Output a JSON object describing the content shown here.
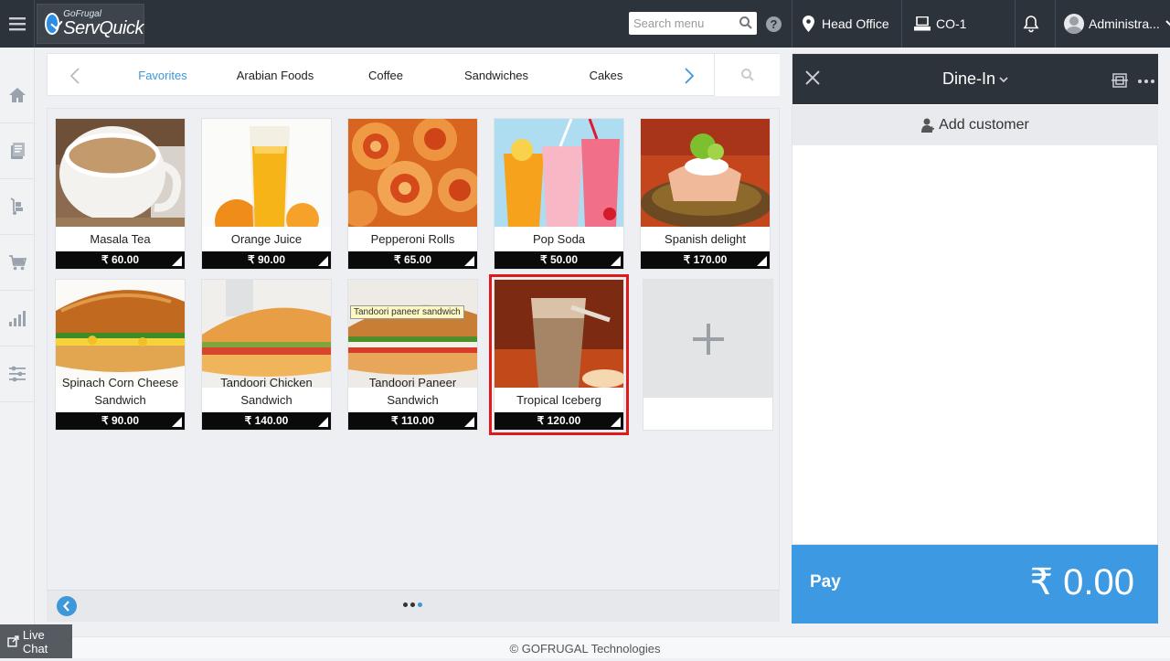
{
  "app": {
    "brand_small": "GoFrugal",
    "brand_big": "ServQuick"
  },
  "topbar": {
    "search_placeholder": "Search menu",
    "help_glyph": "?",
    "location": "Head Office",
    "counter": "CO-1",
    "user": "Administra..."
  },
  "categories": {
    "items": [
      "Favorites",
      "Arabian Foods",
      "Coffee",
      "Sandwiches",
      "Cakes"
    ],
    "active": "Favorites"
  },
  "items": [
    {
      "name": "Masala Tea",
      "price": "₹ 60.00"
    },
    {
      "name": "Orange Juice",
      "price": "₹ 90.00"
    },
    {
      "name": "Pepperoni Rolls",
      "price": "₹ 65.00"
    },
    {
      "name": "Pop Soda",
      "price": "₹ 50.00"
    },
    {
      "name": "Spanish delight",
      "price": "₹ 170.00"
    },
    {
      "name": "Spinach Corn Cheese Sandwich",
      "price": "₹ 90.00"
    },
    {
      "name": "Tandoori Chicken Sandwich",
      "price": "₹ 140.00"
    },
    {
      "name": "Tandoori Paneer Sandwich",
      "price": "₹ 110.00",
      "tooltip": "Tandoori paneer sandwich"
    },
    {
      "name": "Tropical Iceberg",
      "price": "₹ 120.00",
      "selected": true
    }
  ],
  "add_item_glyph": "+",
  "order": {
    "type": "Dine-In",
    "add_customer": "Add customer",
    "pay_label": "Pay",
    "total": "₹ 0.00"
  },
  "footer": {
    "copyright": "© GOFRUGAL Technologies",
    "live_chat": "Live Chat"
  },
  "colors": {
    "topbar": "#2d333b",
    "accent": "#3d97d9",
    "pay": "#3d9ae2",
    "selection": "#e0191b"
  }
}
